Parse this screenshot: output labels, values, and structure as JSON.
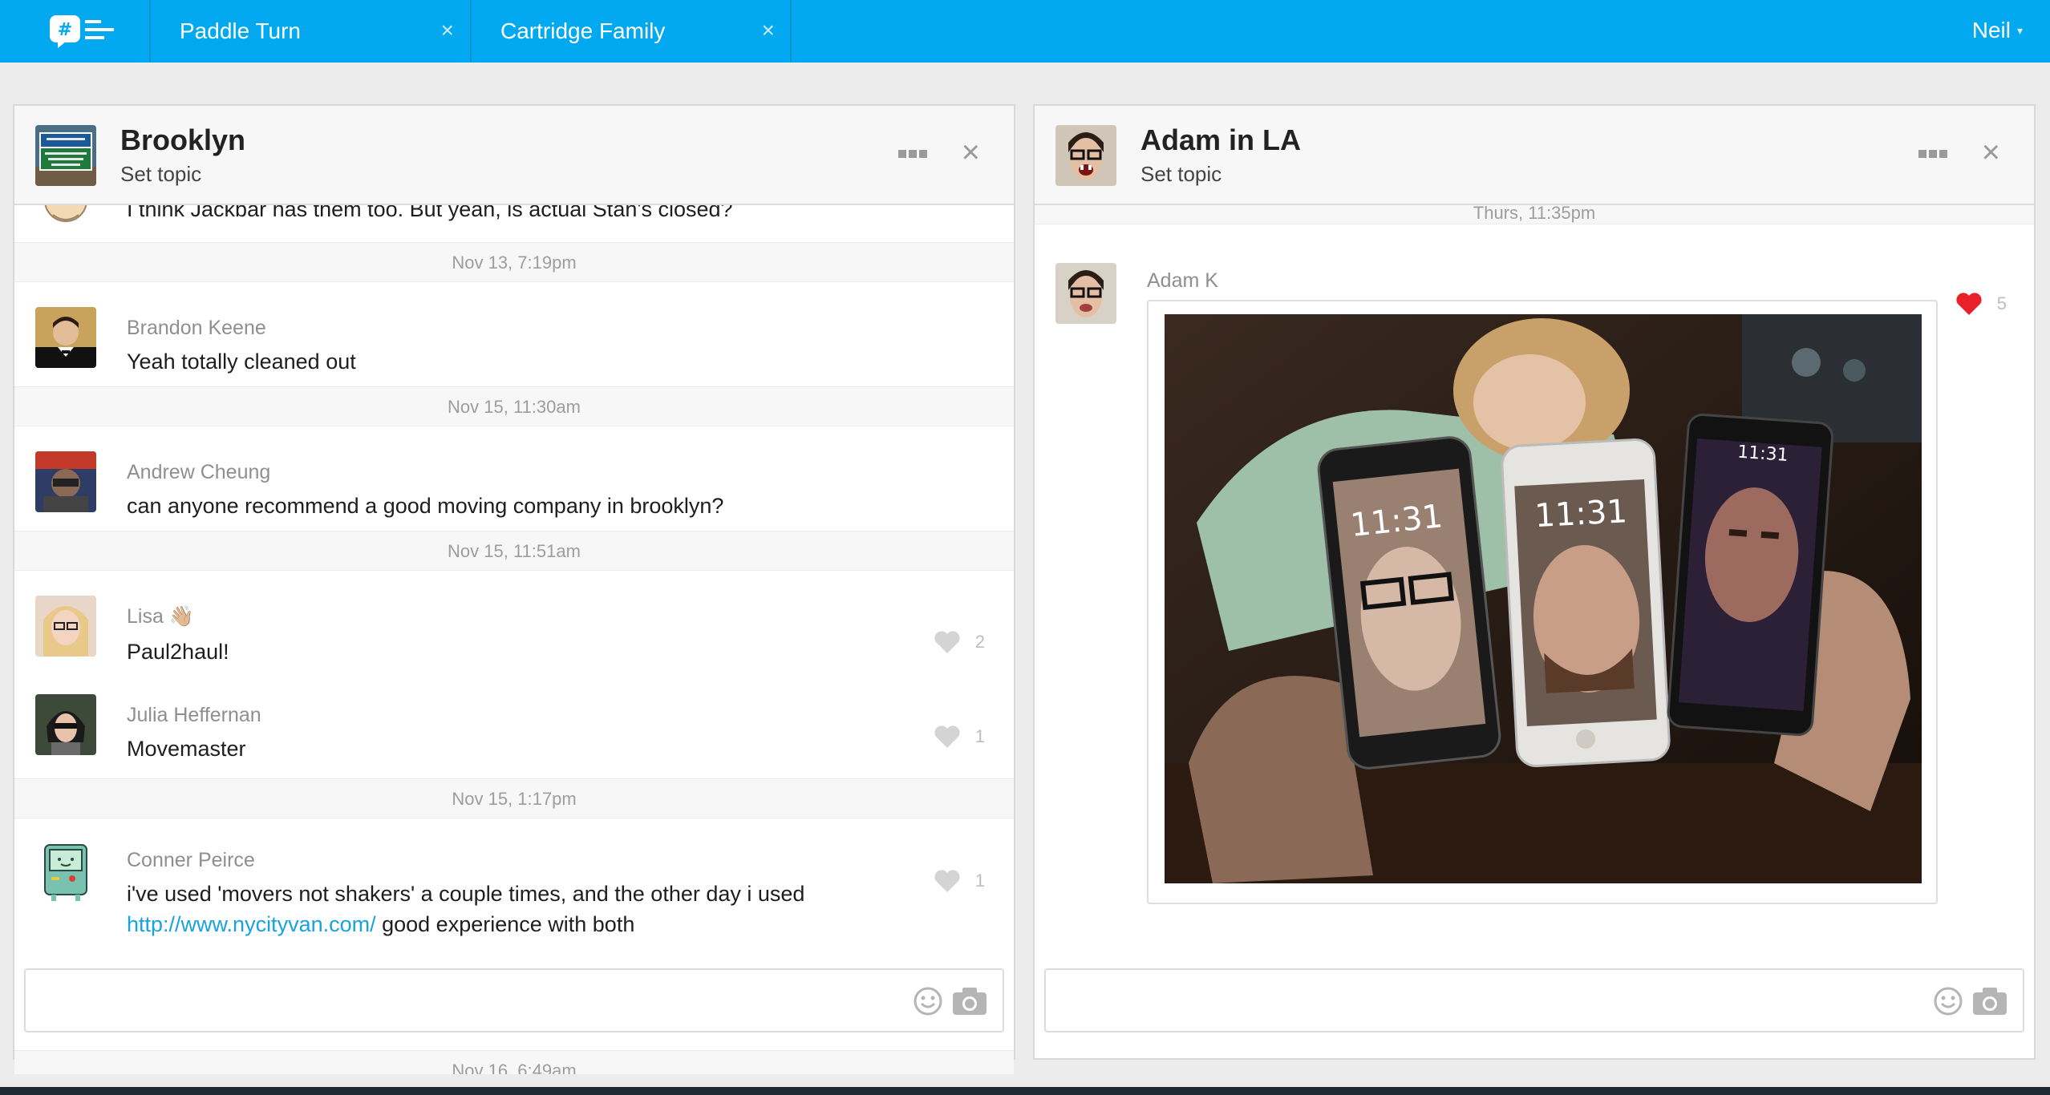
{
  "header": {
    "tabs": [
      {
        "label": "Paddle Turn",
        "close": "×"
      },
      {
        "label": "Cartridge Family",
        "close": "×"
      }
    ],
    "user": "Neil",
    "caret": "▾"
  },
  "left_panel": {
    "title": "Brooklyn",
    "topic": "Set topic",
    "messages": [
      {
        "text": "I think Jackbar has them too. But yeah, is actual Stan's closed?"
      },
      {
        "date": "Nov 13, 7:19pm",
        "author": "Brandon Keene",
        "text": "Yeah totally cleaned out"
      },
      {
        "date": "Nov 15, 11:30am",
        "author": "Andrew Cheung",
        "text": "can anyone recommend a good moving company in brooklyn?"
      },
      {
        "date": "Nov 15, 11:51am",
        "author": "Lisa 👋🏼",
        "text": "Paul2haul!",
        "likes": "2"
      },
      {
        "author": "Julia Heffernan",
        "text": "Movemaster",
        "likes": "1"
      },
      {
        "date": "Nov 15, 1:17pm",
        "author": "Conner Peirce",
        "text_line1": "i've used 'movers not shakers' a couple times, and the other day i used",
        "link": "http://www.nycityvan.com/",
        "text_line2": " good experience with both",
        "likes": "1"
      },
      {
        "date": "Nov 16, 6:49am"
      }
    ]
  },
  "right_panel": {
    "title": "Adam in LA",
    "topic": "Set topic",
    "date": "Thurs, 11:35pm",
    "message": {
      "author": "Adam K",
      "likes": "5",
      "phone_times": [
        "11:31",
        "11:31",
        "11:31"
      ]
    }
  },
  "colors": {
    "brand": "#03a9f0",
    "link": "#17a3e2",
    "heart_active": "#e8202a",
    "heart_inactive": "#d4d4d4"
  },
  "icons": [
    "chat-logo-icon",
    "close-icon",
    "more-icon",
    "heart-icon",
    "emoji-icon",
    "camera-icon"
  ]
}
